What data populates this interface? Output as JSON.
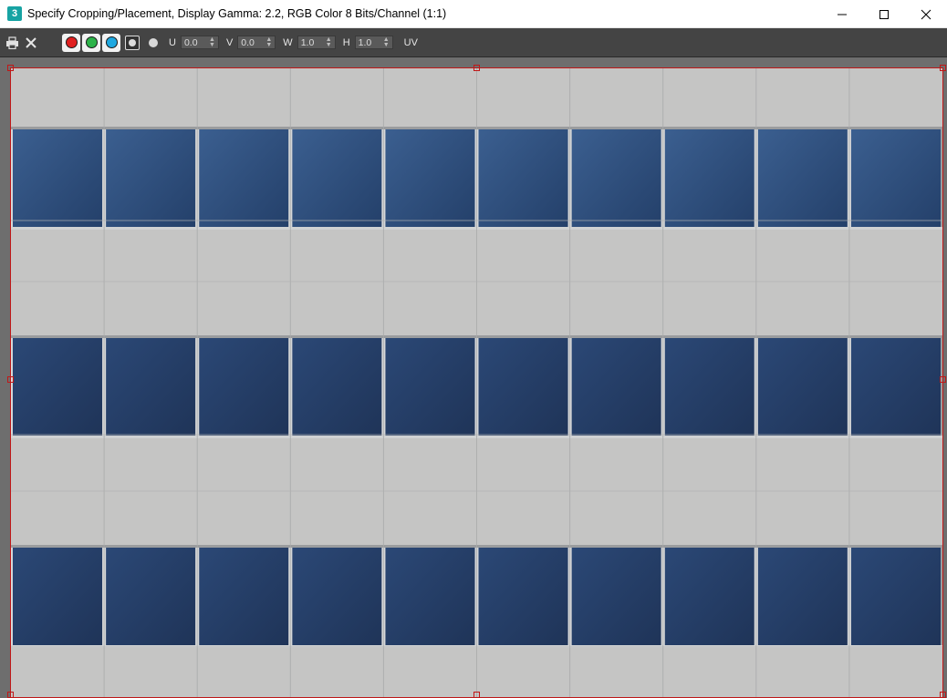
{
  "window": {
    "app_icon_glyph": "3",
    "title": "Specify Cropping/Placement, Display Gamma: 2.2, RGB Color 8 Bits/Channel (1:1)",
    "controls": [
      "minimize-icon",
      "maximize-icon",
      "close-icon"
    ]
  },
  "toolbar": {
    "print_icon": "printer-icon",
    "clear_icon": "x-icon",
    "channels": [
      {
        "name": "red",
        "color": "#e02020"
      },
      {
        "name": "green",
        "color": "#2db34a"
      },
      {
        "name": "blue",
        "color": "#1fa8e0"
      }
    ],
    "alpha_icon": "alpha-channel-icon",
    "mono_icon": "monochrome-icon",
    "u_label": "U",
    "u_value": "0.0",
    "v_label": "V",
    "v_value": "0.0",
    "w_label": "W",
    "w_value": "1.0",
    "h_label": "H",
    "h_value": "1.0",
    "mode_label": "UV"
  },
  "colors": {
    "crop_frame": "#c01818",
    "concrete": "#c5c5c4",
    "glass": "#2f4d78",
    "mullion": "#d6d8da"
  },
  "image": {
    "description_free": true,
    "window_rows": 3,
    "columns": 10
  }
}
